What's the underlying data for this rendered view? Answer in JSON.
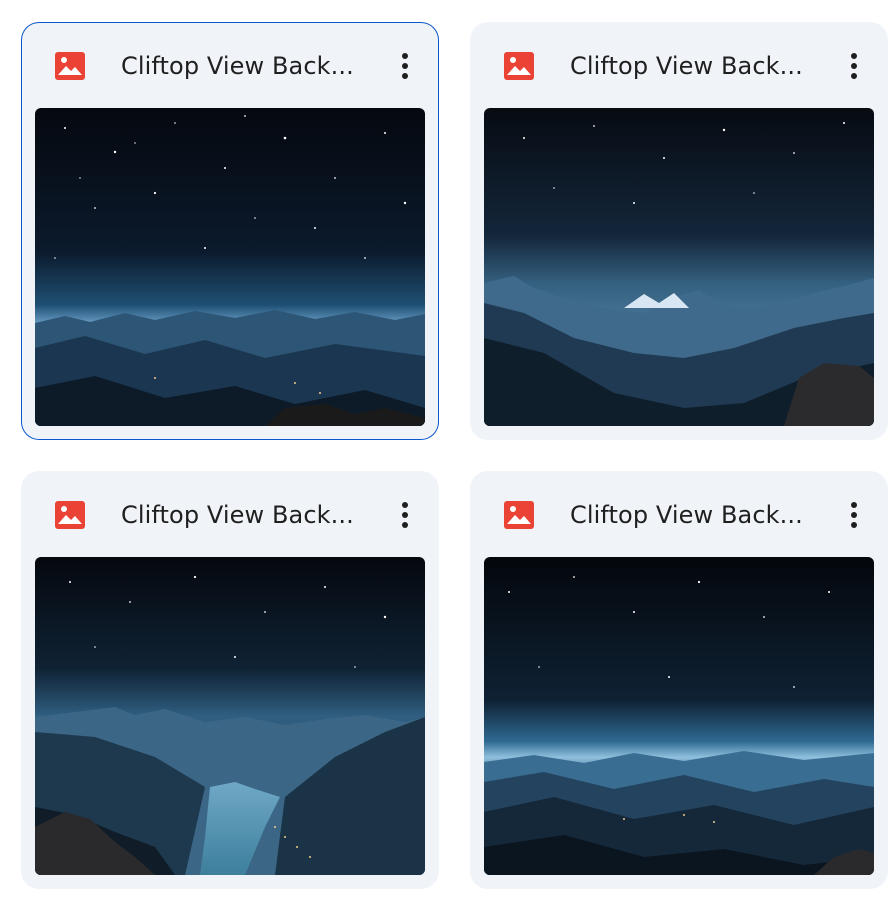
{
  "files": [
    {
      "title": "Cliftop View Back...",
      "type_icon": "image-icon",
      "menu_icon": "more-vert-icon",
      "selected": true
    },
    {
      "title": "Cliftop View Back...",
      "type_icon": "image-icon",
      "menu_icon": "more-vert-icon",
      "selected": false
    },
    {
      "title": "Cliftop View Back...",
      "type_icon": "image-icon",
      "menu_icon": "more-vert-icon",
      "selected": false
    },
    {
      "title": "Cliftop View Back...",
      "type_icon": "image-icon",
      "menu_icon": "more-vert-icon",
      "selected": false
    }
  ],
  "colors": {
    "card_background": "#f0f4f9",
    "selected_border": "#0b57d0",
    "image_icon_red": "#ea4335",
    "title_text": "#1f1f1f"
  }
}
